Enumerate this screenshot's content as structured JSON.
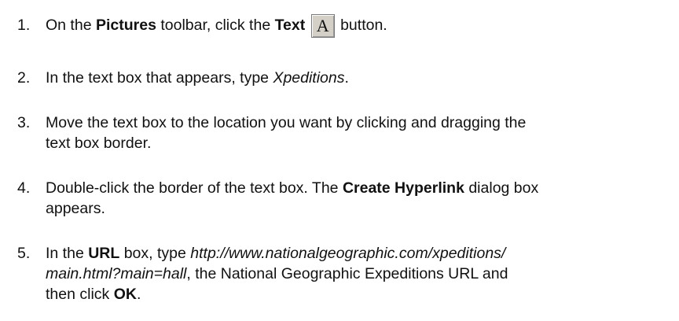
{
  "steps": [
    {
      "number": "1.",
      "parts": {
        "t1": "On the ",
        "b1": "Pictures",
        "t2": " toolbar, click the ",
        "b2": "Text",
        "t3": " ",
        "icon": "A",
        "t4": " button."
      }
    },
    {
      "number": "2.",
      "parts": {
        "t1": "In the text box that appears, type ",
        "i1": "Xpeditions",
        "t2": "."
      }
    },
    {
      "number": "3.",
      "parts": {
        "t1": "Move the text box to the location you want by clicking and dragging the",
        "t2": "text box border."
      }
    },
    {
      "number": "4.",
      "parts": {
        "t1": "Double-click the border of the text box. The ",
        "b1": "Create Hyperlink",
        "t2": " dialog box",
        "t3": "appears."
      }
    },
    {
      "number": "5.",
      "parts": {
        "t1": "In the ",
        "b1": "URL",
        "t2": " box, type ",
        "i1": "http://www.nationalgeographic.com/xpeditions/",
        "i2": "main.html?main=hall",
        "t3": ", the National Geographic Expeditions URL and",
        "t4": "then click ",
        "b2": "OK",
        "t5": "."
      }
    }
  ]
}
